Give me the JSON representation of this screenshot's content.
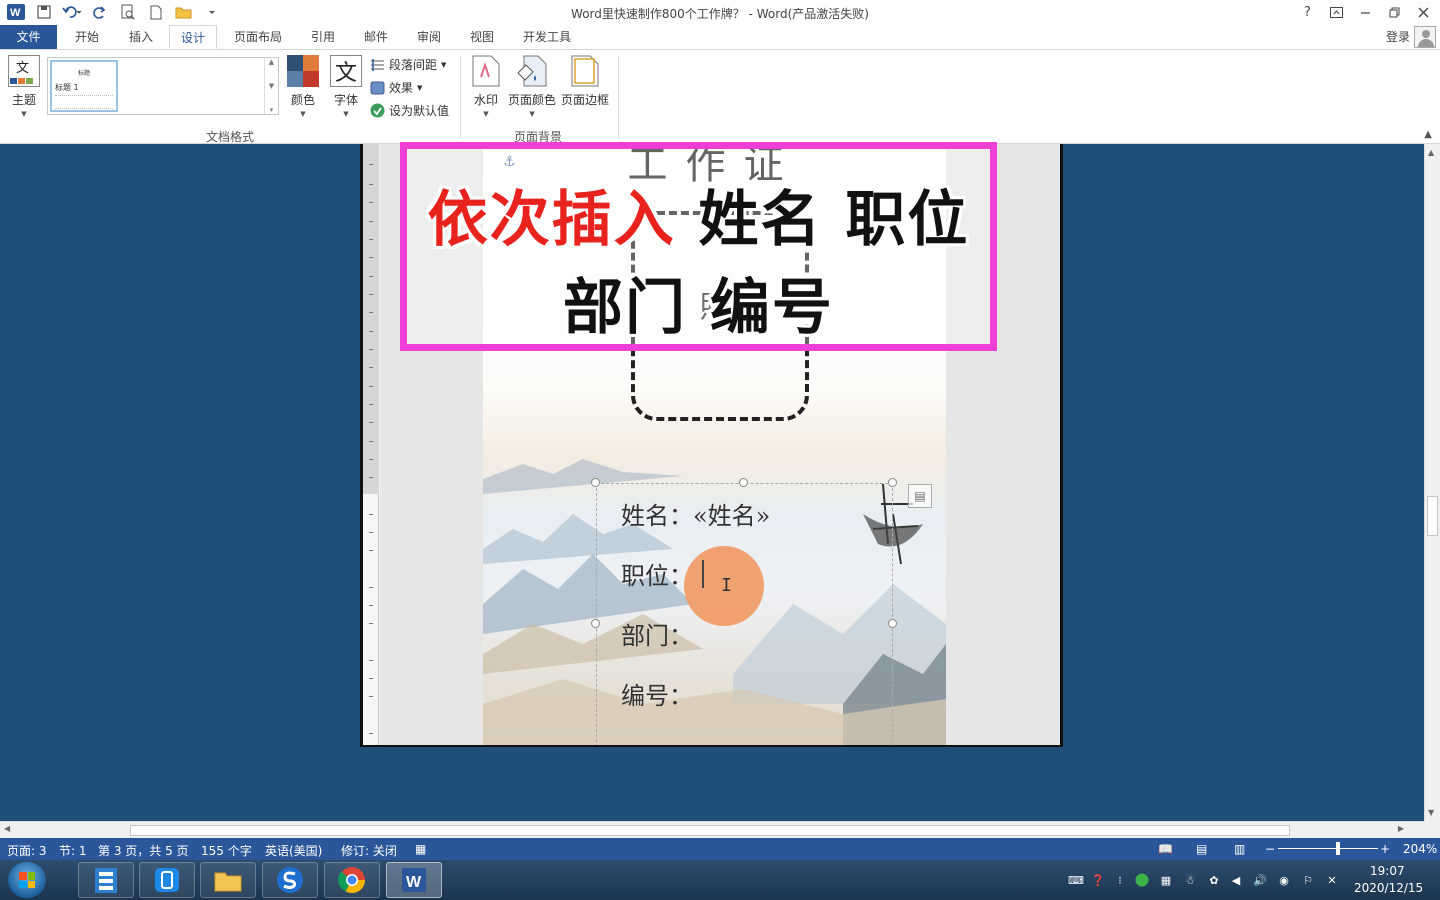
{
  "window": {
    "title": "Word里快速制作800个工作牌？ - Word(产品激活失败)",
    "help": "?",
    "login": "登录"
  },
  "tabs": [
    {
      "label": "文件"
    },
    {
      "label": "开始"
    },
    {
      "label": "插入"
    },
    {
      "label": "设计"
    },
    {
      "label": "页面布局"
    },
    {
      "label": "引用"
    },
    {
      "label": "邮件"
    },
    {
      "label": "审阅"
    },
    {
      "label": "视图"
    },
    {
      "label": "开发工具"
    }
  ],
  "active_tab": "设计",
  "ribbon": {
    "theme": "主题",
    "theme_icon_text": "文",
    "style_thumb_title": "标题",
    "style_thumb_heading": "标题 1",
    "colors": "颜色",
    "fonts": "字体",
    "fonts_icon_text": "文",
    "paragraph_spacing": "段落间距",
    "effects": "效果",
    "set_default": "设为默认值",
    "group_document_format": "文档格式",
    "watermark": "水印",
    "page_color": "页面颜色",
    "page_border": "页面边框",
    "group_page_background": "页面背景"
  },
  "document": {
    "card_title": "工作证",
    "photo_label": "照",
    "photo_label2": "片",
    "field_name": "姓名：«姓名»",
    "field_position": "职位：",
    "field_department": "部门：",
    "field_number": "编号：",
    "overlay_line1_red": "依次插入",
    "overlay_line1_black": "姓名 职位",
    "overlay_line2": "部门 编号"
  },
  "status": {
    "page": "页面: 3",
    "section": "节: 1",
    "page_of": "第 3 页，共 5 页",
    "word_count": "155 个字",
    "language": "英语(美国)",
    "track_changes": "修订: 关闭",
    "zoom": "204%"
  },
  "taskbar": {
    "time": "19:07",
    "date": "2020/12/15"
  },
  "colors": {
    "word_blue": "#2b579a",
    "doc_background": "#1f4e79",
    "overlay_border": "#ee3fd7",
    "overlay_red": "#e8231d",
    "click_indicator": "#f1965f"
  }
}
